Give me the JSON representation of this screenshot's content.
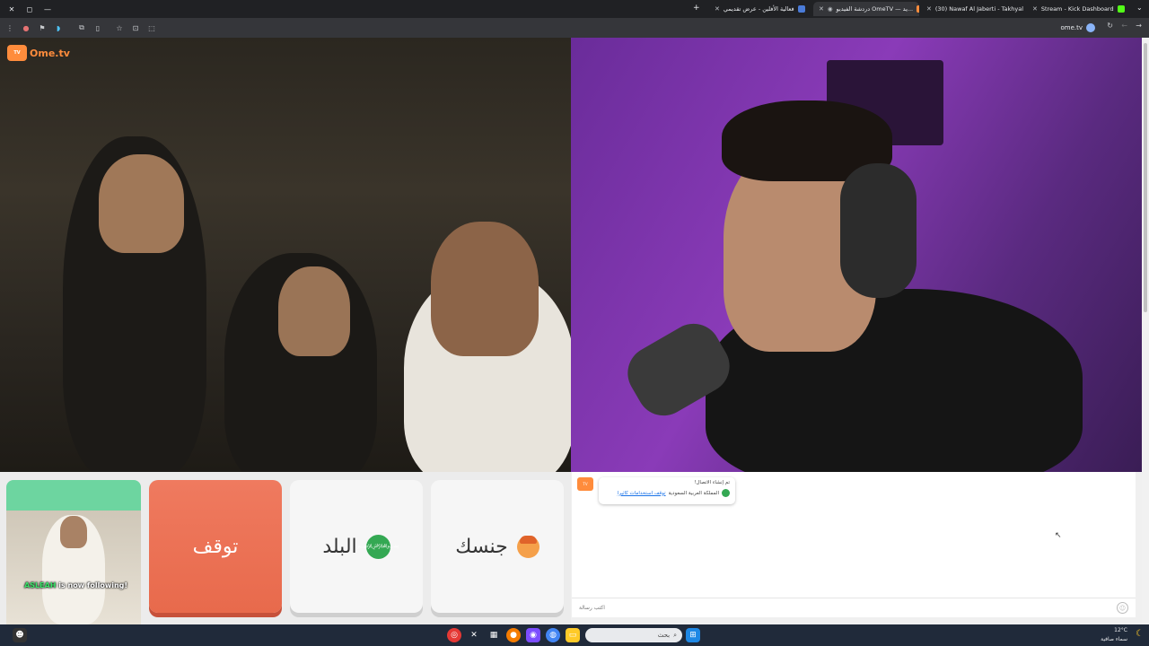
{
  "tabs": [
    {
      "title": "Stream - Kick Dashboard",
      "active": false
    },
    {
      "title": "(30) Nawaf Al Jaberti - Takhyal",
      "active": false
    },
    {
      "title": "دردشة الفيديو OmeTV — يد...",
      "active": true
    },
    {
      "title": "فعالية الأفلين - عرض تقديمي",
      "active": false
    }
  ],
  "address": {
    "domain": "ome.tv"
  },
  "logo_text": "Ome.tv",
  "controls": {
    "stop_label": "توقف",
    "country_label": "البلد",
    "gender_label": "جنسك"
  },
  "follow_alert": {
    "username": "ASLEAH",
    "text": "is now following!"
  },
  "chat": {
    "msg_line1": "تم إنشاء الاتصال!",
    "msg_country": "المملكة العربية السعودية",
    "msg_link": "توقف استخدامات كاثيرا",
    "input_placeholder": "اكتب رسالة"
  },
  "taskbar": {
    "search_placeholder": "بحث",
    "temperature": "12°C",
    "weather_desc": "سماء صافية"
  },
  "colors": {
    "stop_button": "#e86a4c",
    "brand_orange": "#ff8c3c",
    "selfcam_top": "#6dd5a0"
  }
}
